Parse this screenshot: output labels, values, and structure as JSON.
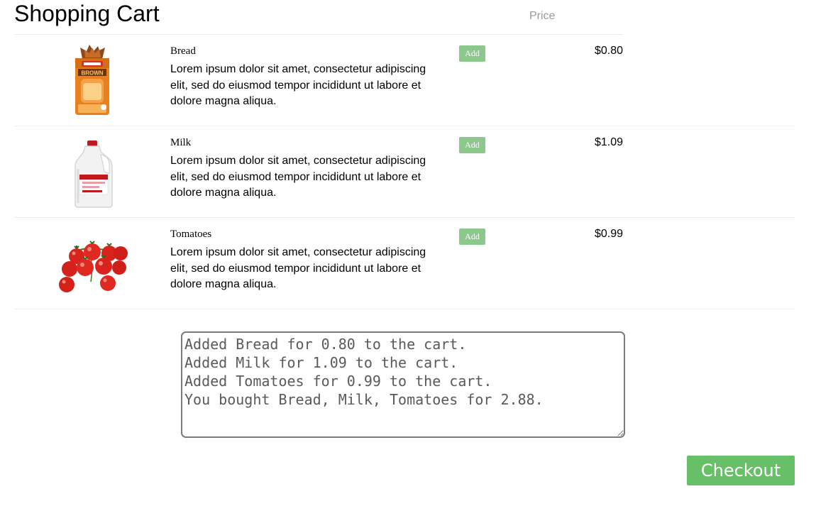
{
  "header": {
    "title": "Shopping Cart",
    "price_label": "Price"
  },
  "products": [
    {
      "name": "Bread",
      "description": "Lorem ipsum dolor sit amet, consectetur adipiscing elit, sed do eiusmod tempor incididunt ut labore et dolore magna aliqua.",
      "add_label": "Add",
      "price": "$0.80",
      "image_icon": "bread-icon",
      "image_text": "BROWN"
    },
    {
      "name": "Milk",
      "description": "Lorem ipsum dolor sit amet, consectetur adipiscing elit, sed do eiusmod tempor incididunt ut labore et dolore magna aliqua.",
      "add_label": "Add",
      "price": "$1.09",
      "image_icon": "milk-jug-icon"
    },
    {
      "name": "Tomatoes",
      "description": "Lorem ipsum dolor sit amet, consectetur adipiscing elit, sed do eiusmod tempor incididunt ut labore et dolore magna aliqua.",
      "add_label": "Add",
      "price": "$0.99",
      "image_icon": "tomatoes-icon"
    }
  ],
  "log": {
    "text": "Added Bread for 0.80 to the cart.\nAdded Milk for 1.09 to the cart.\nAdded Tomatoes for 0.99 to the cart.\nYou bought Bread, Milk, Tomatoes for 2.88."
  },
  "checkout": {
    "label": "Checkout"
  },
  "colors": {
    "add_button": "#8cc88c",
    "checkout_button": "#67bf67",
    "divider": "#ececec",
    "log_text": "#5a5a5a"
  }
}
